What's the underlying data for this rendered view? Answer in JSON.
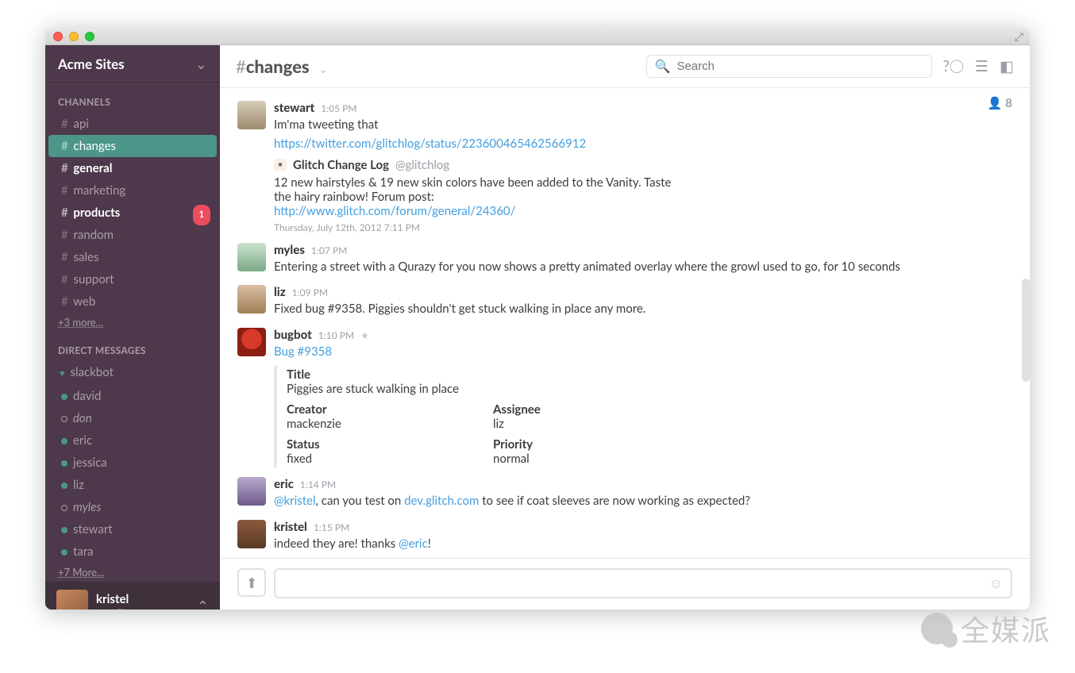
{
  "workspace": {
    "name": "Acme Sites"
  },
  "sidebar": {
    "channels_title": "CHANNELS",
    "channels": [
      {
        "name": "api",
        "bold": false,
        "active": false,
        "badge": null
      },
      {
        "name": "changes",
        "bold": false,
        "active": true,
        "badge": null
      },
      {
        "name": "general",
        "bold": true,
        "active": false,
        "badge": null
      },
      {
        "name": "marketing",
        "bold": false,
        "active": false,
        "badge": null
      },
      {
        "name": "products",
        "bold": true,
        "active": false,
        "badge": "1"
      },
      {
        "name": "random",
        "bold": false,
        "active": false,
        "badge": null
      },
      {
        "name": "sales",
        "bold": false,
        "active": false,
        "badge": null
      },
      {
        "name": "support",
        "bold": false,
        "active": false,
        "badge": null
      },
      {
        "name": "web",
        "bold": false,
        "active": false,
        "badge": null
      }
    ],
    "channels_more": "+3 more...",
    "dms_title": "DIRECT MESSAGES",
    "dms": [
      {
        "name": "slackbot",
        "presence": "heart",
        "italic": false
      },
      {
        "name": "david",
        "presence": "online",
        "italic": false
      },
      {
        "name": "don",
        "presence": "away",
        "italic": true
      },
      {
        "name": "eric",
        "presence": "online",
        "italic": false
      },
      {
        "name": "jessica",
        "presence": "online",
        "italic": false
      },
      {
        "name": "liz",
        "presence": "online",
        "italic": false
      },
      {
        "name": "myles",
        "presence": "away",
        "italic": true
      },
      {
        "name": "stewart",
        "presence": "online",
        "italic": false
      },
      {
        "name": "tara",
        "presence": "online",
        "italic": false
      }
    ],
    "dms_more": "+7 More...",
    "me": {
      "name": "kristel",
      "status": "online"
    }
  },
  "header": {
    "channel": "changes",
    "search_placeholder": "Search",
    "members": "8"
  },
  "messages": {
    "stewart": {
      "author": "stewart",
      "time": "1:05 PM",
      "text": "Im'ma tweeting that",
      "link": "https://twitter.com/glitchlog/status/223600465462566912",
      "embed": {
        "title": "Glitch Change Log",
        "handle": "@glitchlog",
        "body1": "12 new hairstyles & 19 new skin colors have been added to the Vanity. Taste",
        "body2": "the hairy rainbow! Forum post:",
        "body_link": "http://www.glitch.com/forum/general/24360/",
        "meta": "Thursday, July 12th, 2012 7:11 PM"
      }
    },
    "myles": {
      "author": "myles",
      "time": "1:07 PM",
      "text": "Entering a street with a Qurazy for you now shows a pretty animated overlay where the growl used to go, for 10 seconds"
    },
    "liz": {
      "author": "liz",
      "time": "1:09 PM",
      "text": "Fixed bug #9358. Piggies shouldn't get stuck walking in place any more."
    },
    "bugbot": {
      "author": "bugbot",
      "time": "1:10 PM",
      "link": "Bug #9358",
      "card": {
        "title_label": "Title",
        "title": "Piggies are stuck walking in place",
        "creator_label": "Creator",
        "creator": "mackenzie",
        "assignee_label": "Assignee",
        "assignee": "liz",
        "status_label": "Status",
        "status": "fixed",
        "priority_label": "Priority",
        "priority": "normal"
      }
    },
    "eric": {
      "author": "eric",
      "time": "1:14 PM",
      "mention": "@kristel",
      "text1": ", can you test on ",
      "link": "dev.glitch.com",
      "text2": " to see if coat sleeves are now working as expected?"
    },
    "kristel": {
      "author": "kristel",
      "time": "1:15 PM",
      "text1": "indeed they are! thanks ",
      "mention": "@eric",
      "text2": "!"
    }
  },
  "watermark": "全媒派"
}
